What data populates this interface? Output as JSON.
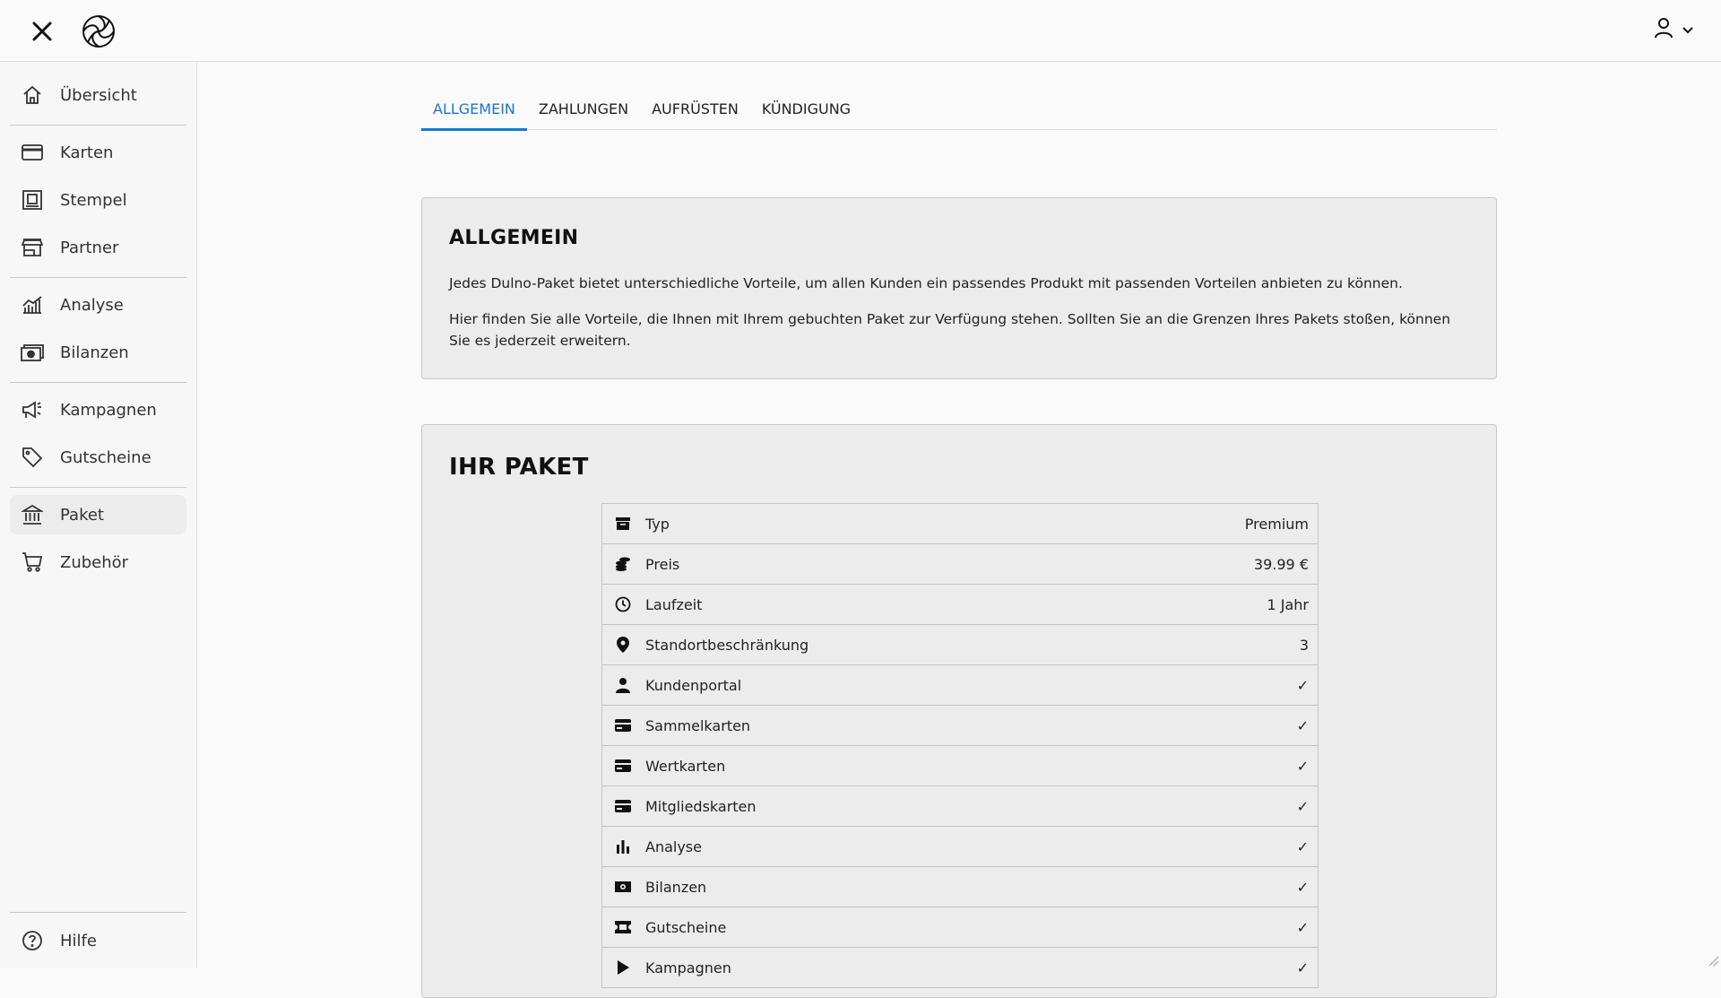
{
  "topbar": {
    "close_icon": "close-icon",
    "logo_icon": "swirl-logo-icon",
    "user_icon": "user-icon"
  },
  "sidebar": {
    "items": [
      {
        "label": "Übersicht",
        "icon": "home-icon"
      },
      {
        "label": "Karten",
        "icon": "card-icon"
      },
      {
        "label": "Stempel",
        "icon": "stamp-icon"
      },
      {
        "label": "Partner",
        "icon": "store-icon"
      },
      {
        "label": "Analyse",
        "icon": "chart-icon"
      },
      {
        "label": "Bilanzen",
        "icon": "money-icon"
      },
      {
        "label": "Kampagnen",
        "icon": "megaphone-icon"
      },
      {
        "label": "Gutscheine",
        "icon": "tag-icon"
      },
      {
        "label": "Paket",
        "icon": "bank-icon"
      },
      {
        "label": "Zubehör",
        "icon": "cart-icon"
      }
    ],
    "help": {
      "label": "Hilfe",
      "icon": "help-icon"
    },
    "active": "Paket"
  },
  "tabs": [
    "ALLGEMEIN",
    "ZAHLUNGEN",
    "AUFRÜSTEN",
    "KÜNDIGUNG"
  ],
  "allgemein": {
    "title": "ALLGEMEIN",
    "p1": "Jedes Dulno-Paket bietet unterschiedliche Vorteile, um allen Kunden ein passendes Produkt mit passenden Vorteilen anbieten zu können.",
    "p2": "Hier finden Sie alle Vorteile, die Ihnen mit Ihrem gebuchten Paket zur Verfügung stehen. Sollten Sie an die Grenzen Ihres Pakets stoßen, können Sie es jederzeit erweitern."
  },
  "paket": {
    "title": "IHR PAKET",
    "rows": [
      {
        "label": "Typ",
        "value": "Premium",
        "icon": "box-icon"
      },
      {
        "label": "Preis",
        "value": "39.99 €",
        "icon": "coins-icon"
      },
      {
        "label": "Laufzeit",
        "value": "1 Jahr",
        "icon": "clock-icon"
      },
      {
        "label": "Standortbeschränkung",
        "value": "3",
        "icon": "location-pin-icon"
      },
      {
        "label": "Kundenportal",
        "value": "✓",
        "icon": "person-icon"
      },
      {
        "label": "Sammelkarten",
        "value": "✓",
        "icon": "card-icon"
      },
      {
        "label": "Wertkarten",
        "value": "✓",
        "icon": "card-icon"
      },
      {
        "label": "Mitgliedskarten",
        "value": "✓",
        "icon": "card-icon"
      },
      {
        "label": "Analyse",
        "value": "✓",
        "icon": "bar-chart-icon"
      },
      {
        "label": "Bilanzen",
        "value": "✓",
        "icon": "money-icon"
      },
      {
        "label": "Gutscheine",
        "value": "✓",
        "icon": "ticket-icon"
      },
      {
        "label": "Kampagnen",
        "value": "✓",
        "icon": "play-icon"
      }
    ]
  }
}
